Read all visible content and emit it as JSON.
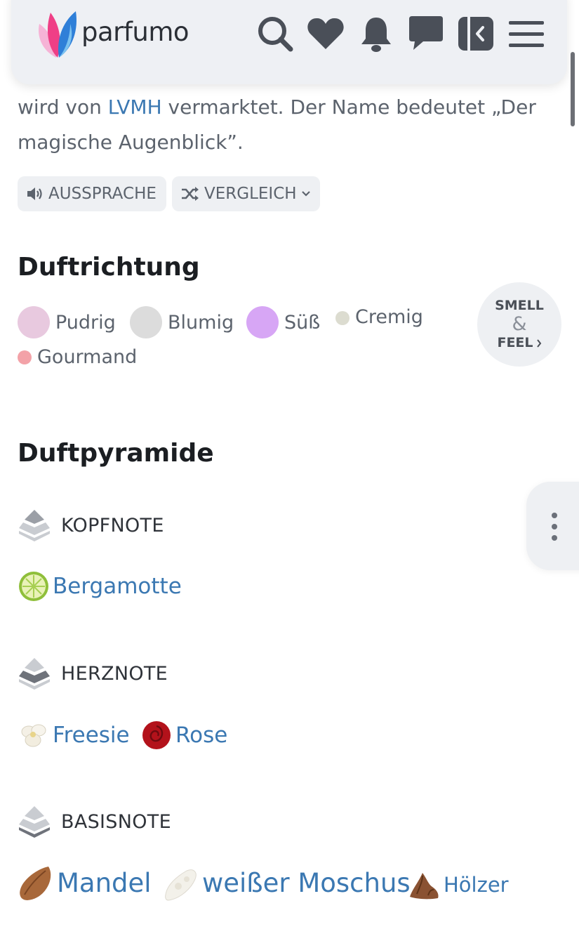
{
  "header": {
    "logo_text": "parfumo",
    "icons": [
      "search-icon",
      "heart-icon",
      "bell-icon",
      "chat-icon",
      "panel-collapse-icon",
      "menu-icon"
    ]
  },
  "intro": {
    "line1_before": "wird von ",
    "line1_link": "LVMH",
    "line1_after": " vermarktet. Der Name bedeutet „Der",
    "line2": "magische Augenblick”."
  },
  "actions": {
    "pronunciation_label": "AUSSPRACHE",
    "compare_label": "VERGLEICH"
  },
  "scent_direction": {
    "title": "Duftrichtung",
    "accords": [
      {
        "label": "Pudrig",
        "color": "#e8c9df"
      },
      {
        "label": "Blumig",
        "color": "#dcdcdc"
      },
      {
        "label": "Süß",
        "color": "#d7a6f5"
      },
      {
        "label": "Cremig",
        "color": "#dcdcd0"
      },
      {
        "label": "Gourmand",
        "color": "#f3a2a8"
      }
    ],
    "smell_feel": {
      "top": "SMELL",
      "amp": "&",
      "bottom": "FEEL"
    }
  },
  "pyramid": {
    "title": "Duftpyramide",
    "top": {
      "label": "KOPFNOTE",
      "notes": [
        "Bergamotte"
      ]
    },
    "heart": {
      "label": "HERZNOTE",
      "notes": [
        "Freesie",
        "Rose"
      ]
    },
    "base": {
      "label": "BASISNOTE",
      "notes": [
        "Mandel",
        "weißer Moschus",
        "Hölzer"
      ]
    }
  },
  "colors": {
    "link": "#3b78b2",
    "heading": "#1b1e22",
    "body_text": "#5c636d",
    "header_bg": "#eef0f4"
  }
}
